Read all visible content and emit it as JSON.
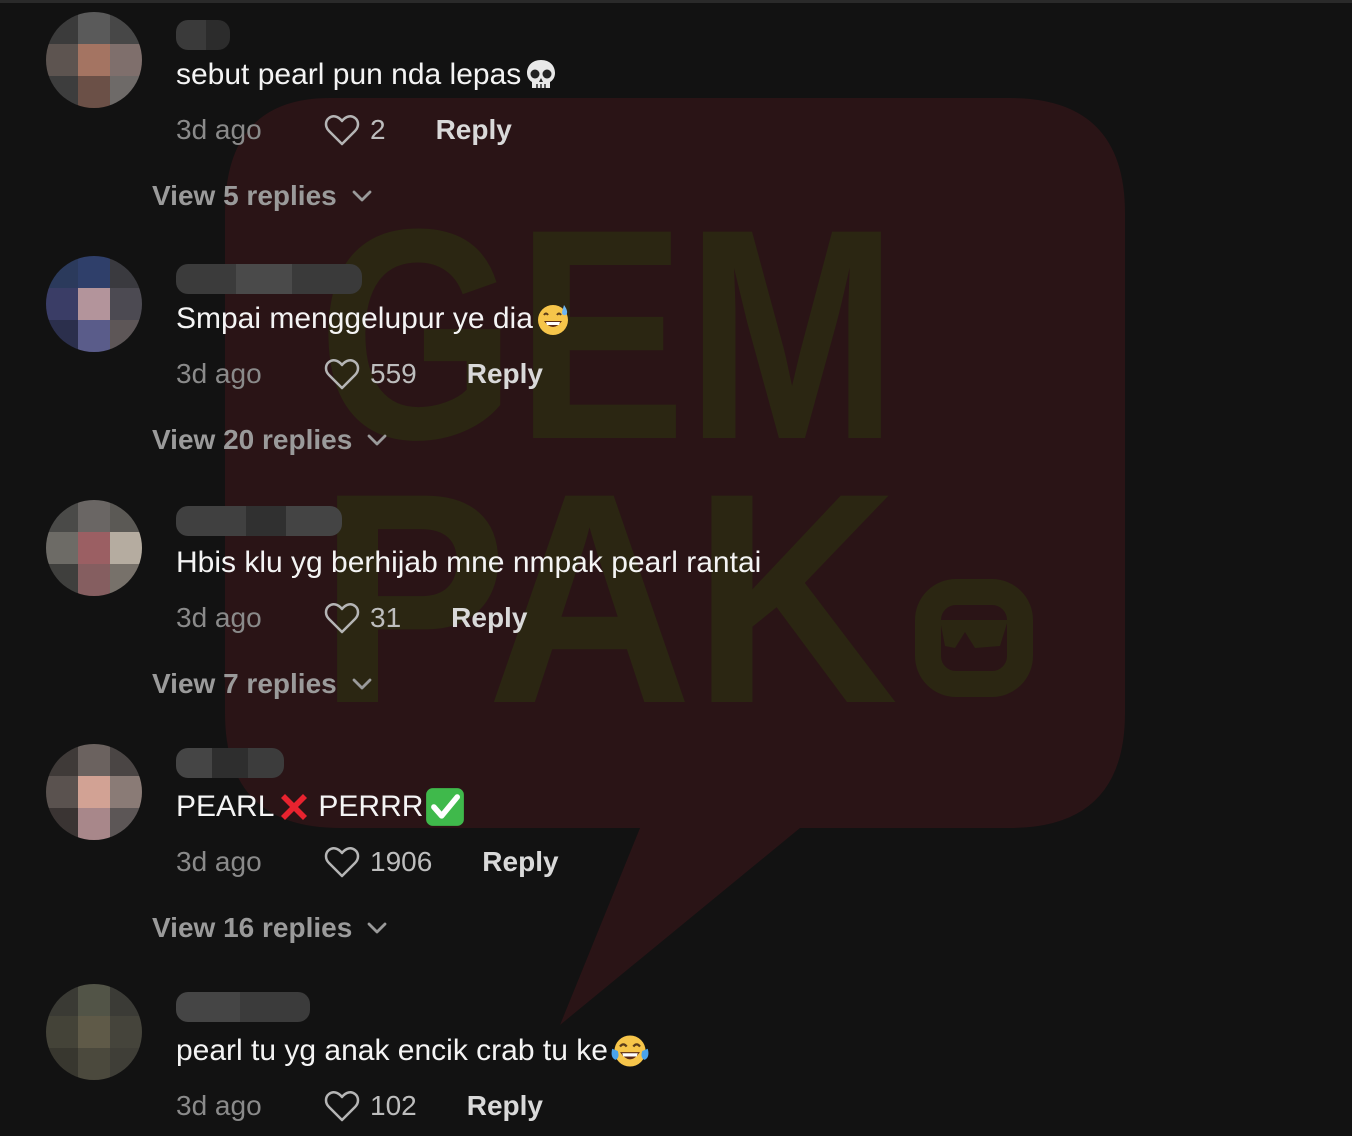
{
  "comments": [
    {
      "text": "sebut pearl pun nda lepas",
      "emoji": "skull",
      "time": "3d ago",
      "likes": "2",
      "reply_label": "Reply",
      "view_replies": "View 5 replies"
    },
    {
      "text": "Smpai menggelupur ye dia",
      "emoji": "grinning-sweat",
      "time": "3d ago",
      "likes": "559",
      "reply_label": "Reply",
      "view_replies": "View 20 replies"
    },
    {
      "text": "Hbis klu yg berhijab mne nmpak pearl rantai",
      "emoji": "",
      "time": "3d ago",
      "likes": "31",
      "reply_label": "Reply",
      "view_replies": "View 7 replies"
    },
    {
      "text_a": "PEARL",
      "text_b": "PERRR",
      "emoji": "cross-mark,check-mark",
      "time": "3d ago",
      "likes": "1906",
      "reply_label": "Reply",
      "view_replies": "View 16 replies"
    },
    {
      "text": "pearl tu yg anak encik crab tu ke",
      "emoji": "tears-of-joy",
      "time": "3d ago",
      "likes": "102",
      "reply_label": "Reply"
    }
  ],
  "watermark": {
    "line1": "GEM",
    "line2": "PAK"
  },
  "icons": {
    "like": "heart-outline-icon",
    "expand": "chevron-down-icon"
  },
  "colors": {
    "background": "#121212",
    "text": "#f4f4f4",
    "muted": "#8a8a8a",
    "watermark_red": "#2a1416",
    "watermark_yellow": "#2b2612"
  }
}
